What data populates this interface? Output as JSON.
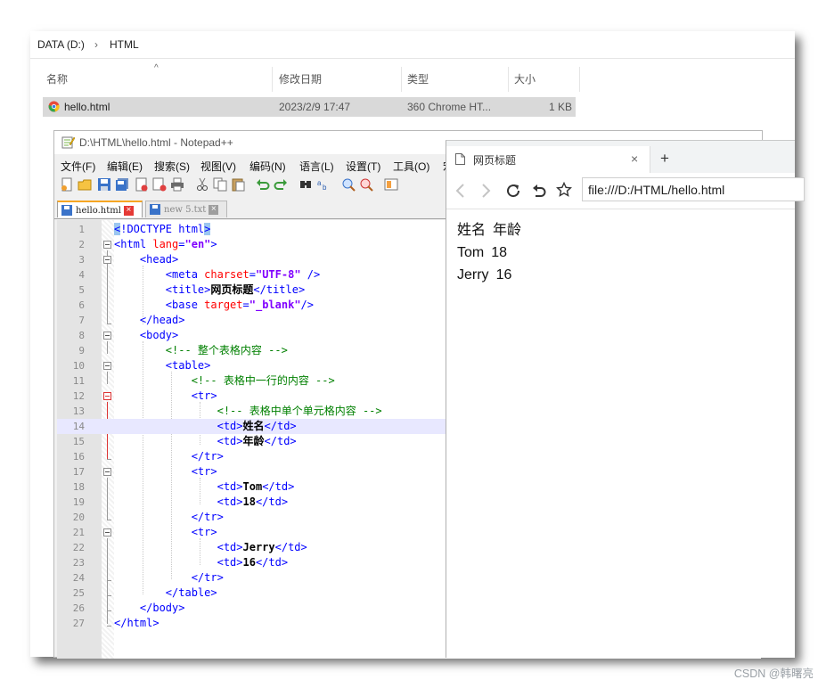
{
  "explorer": {
    "breadcrumb": [
      "DATA (D:)",
      "HTML"
    ],
    "breadcrumb_separator": "›",
    "columns": [
      "名称",
      "修改日期",
      "类型",
      "大小"
    ],
    "sort_indicator": "^",
    "files": [
      {
        "name": "hello.html",
        "modified": "2023/2/9 17:47",
        "type": "360 Chrome HT...",
        "size": "1 KB"
      }
    ]
  },
  "notepad": {
    "title": "D:\\HTML\\hello.html - Notepad++",
    "menu": [
      "文件(F)",
      "编辑(E)",
      "搜索(S)",
      "视图(V)",
      "编码(N)",
      "语言(L)",
      "设置(T)",
      "工具(O)",
      "宏"
    ],
    "tabs": [
      {
        "label": "hello.html",
        "active": true
      },
      {
        "label": "new 5.txt",
        "active": false
      }
    ],
    "current_line": 14,
    "lines": [
      "1",
      "2",
      "3",
      "4",
      "5",
      "6",
      "7",
      "8",
      "9",
      "10",
      "11",
      "12",
      "13",
      "14",
      "15",
      "16",
      "17",
      "18",
      "19",
      "20",
      "21",
      "22",
      "23",
      "24",
      "25",
      "26",
      "27"
    ],
    "code": {
      "doctype": "!DOCTYPE html",
      "lang_value": "\"en\"",
      "charset_value": "\"UTF-8\"",
      "page_title": "网页标题",
      "base_target": "\"_blank\"",
      "comment_table": "<!-- 整个表格内容 -->",
      "comment_row": "<!-- 表格中一行的内容 -->",
      "comment_cell": "<!-- 表格中单个单元格内容 -->",
      "cells": [
        "姓名",
        "年龄",
        "Tom",
        "18",
        "Jerry",
        "16"
      ]
    }
  },
  "browser": {
    "tab_title": "网页标题",
    "tab_close": "×",
    "new_tab": "+",
    "url": "file:///D:/HTML/hello.html",
    "table": [
      [
        "姓名",
        "年龄"
      ],
      [
        "Tom",
        "18"
      ],
      [
        "Jerry",
        "16"
      ]
    ]
  },
  "watermark": "CSDN @韩曙亮"
}
